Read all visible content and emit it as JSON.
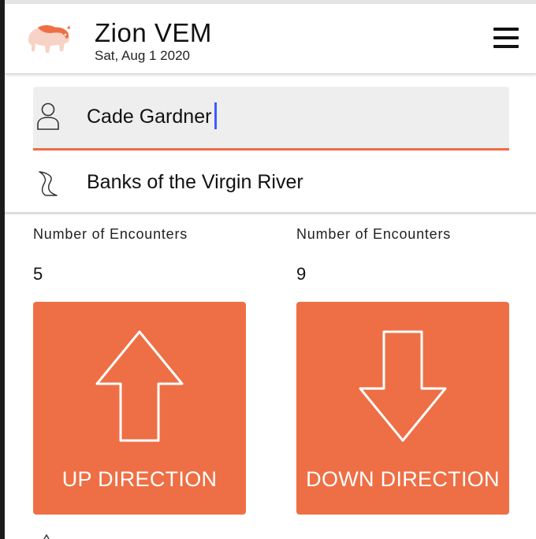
{
  "app": {
    "title": "Zion VEM",
    "date": "Sat, Aug 1 2020",
    "logo_icon": "bison-logo",
    "menu_icon": "hamburger-menu-icon"
  },
  "form": {
    "name_value": "Cade Gardner",
    "location_value": "Banks of the Virgin River"
  },
  "counters": [
    {
      "label": "Number of Encounters",
      "value": "5",
      "button_label": "UP DIRECTION",
      "icon": "arrow-up-icon"
    },
    {
      "label": "Number of Encounters",
      "value": "9",
      "button_label": "DOWN DIRECTION",
      "icon": "arrow-down-icon"
    }
  ],
  "colors": {
    "accent": "#ee6f45",
    "underline": "#ee6c43",
    "caret": "#3d5afe",
    "field_bg": "#eeeeee"
  }
}
